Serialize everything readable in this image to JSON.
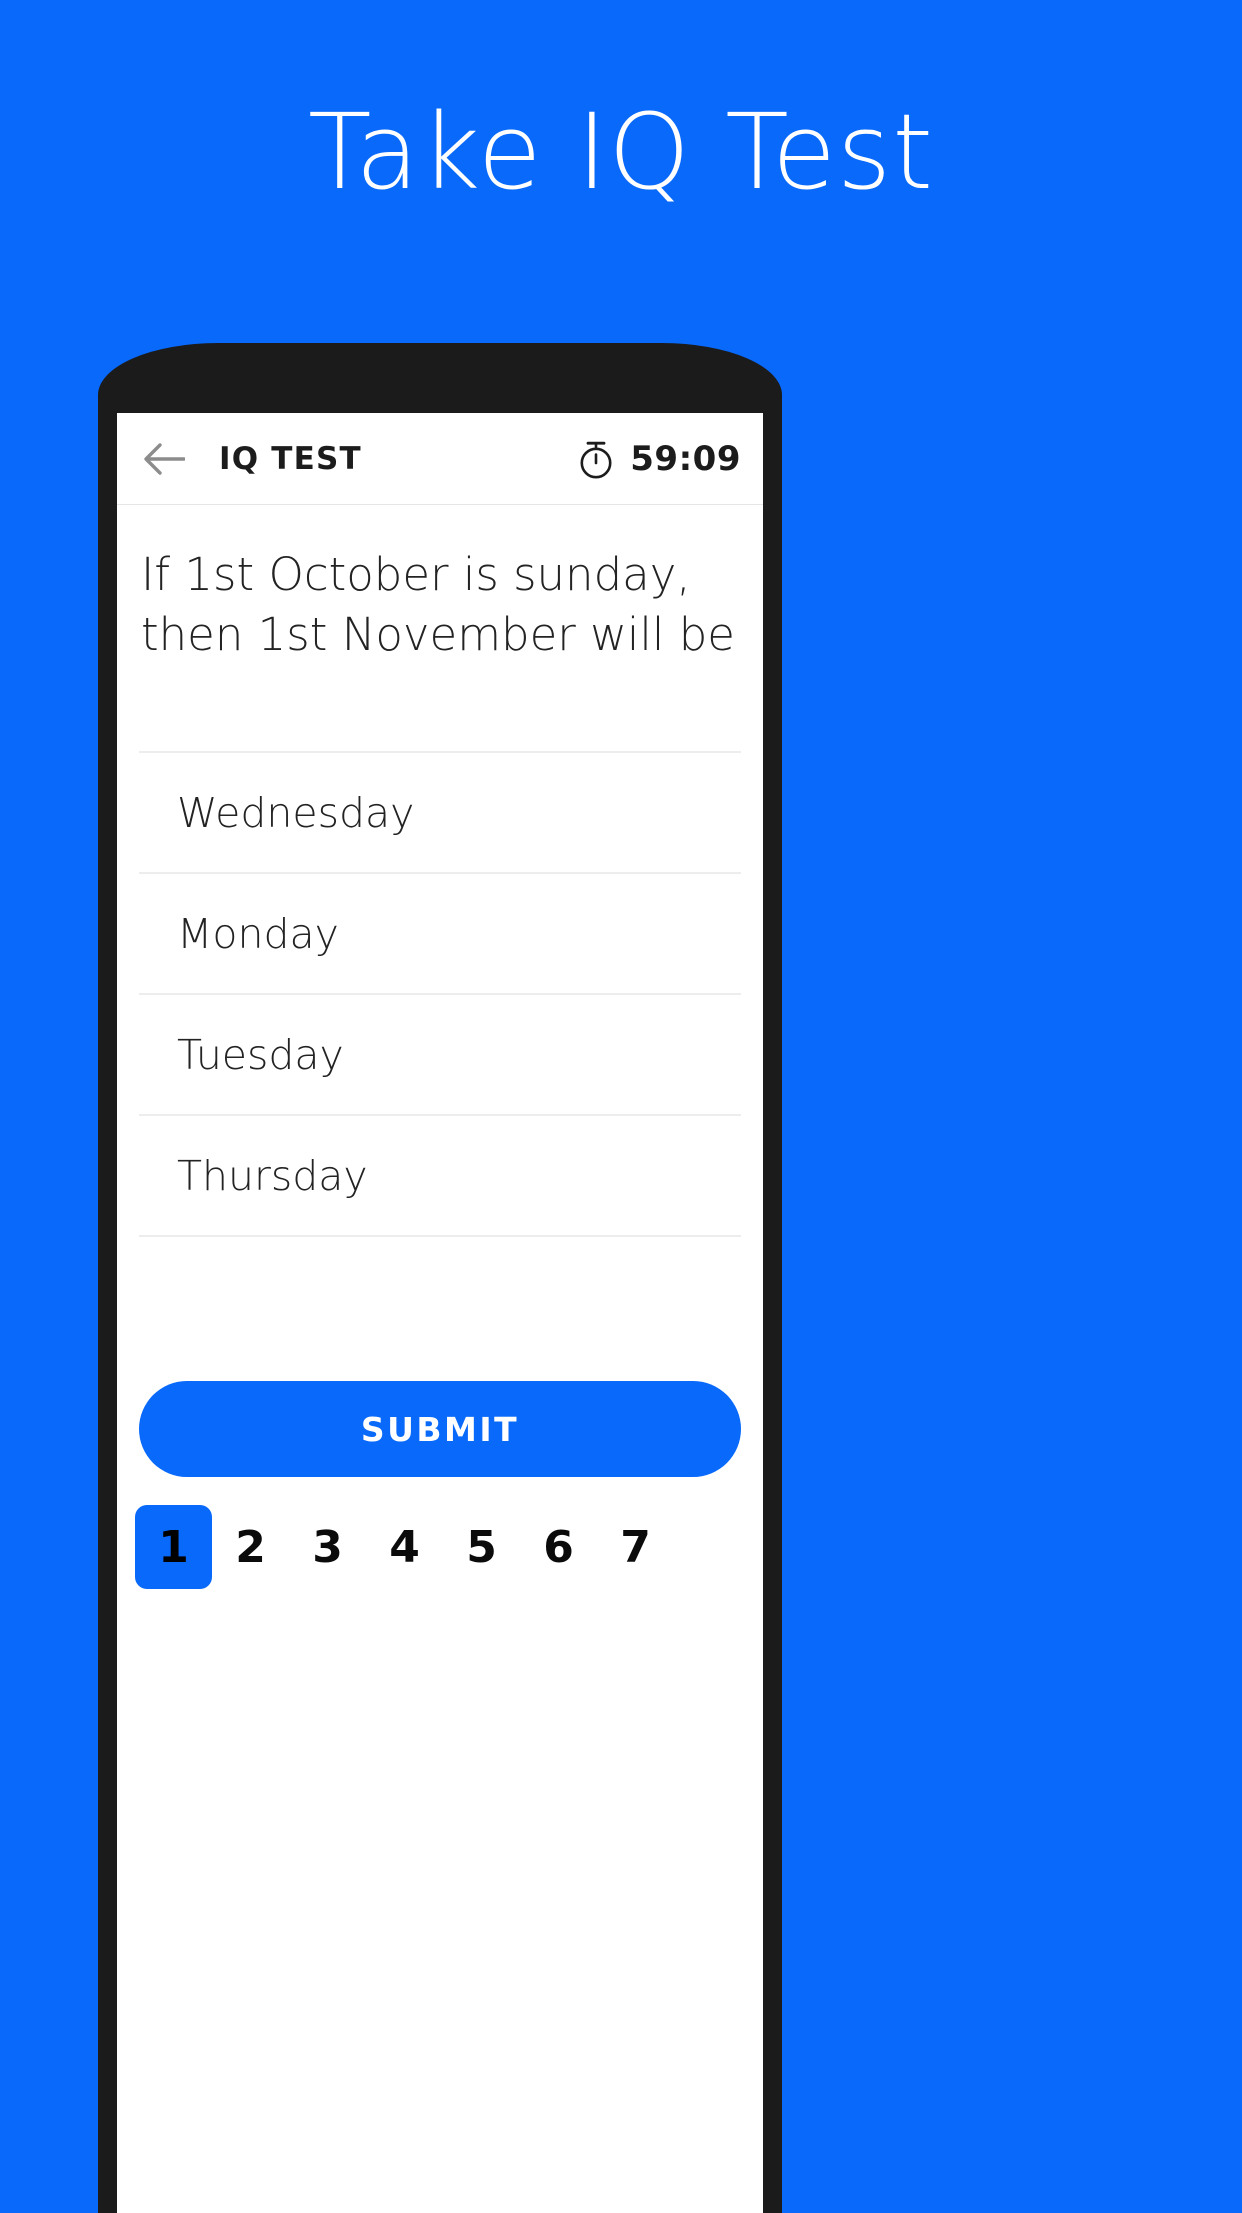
{
  "promo": {
    "headline": "Take IQ Test",
    "background_color": "#0869FB",
    "headline_color": "#FFFFFF"
  },
  "app": {
    "appbar": {
      "back_icon": "back-arrow-icon",
      "title": "IQ TEST",
      "timer_icon": "stopwatch-icon",
      "timer_value": "59:09"
    },
    "question": {
      "text": "If 1st October is sunday, then 1st November will be"
    },
    "options": [
      {
        "label": "Wednesday"
      },
      {
        "label": "Monday"
      },
      {
        "label": "Tuesday"
      },
      {
        "label": "Thursday"
      }
    ],
    "submit": {
      "label": "SUBMIT",
      "color": "#0869FB"
    },
    "pagination": {
      "active": "1",
      "pages": [
        "1",
        "2",
        "3",
        "4",
        "5",
        "6",
        "7"
      ],
      "active_color": "#0869FB"
    }
  }
}
